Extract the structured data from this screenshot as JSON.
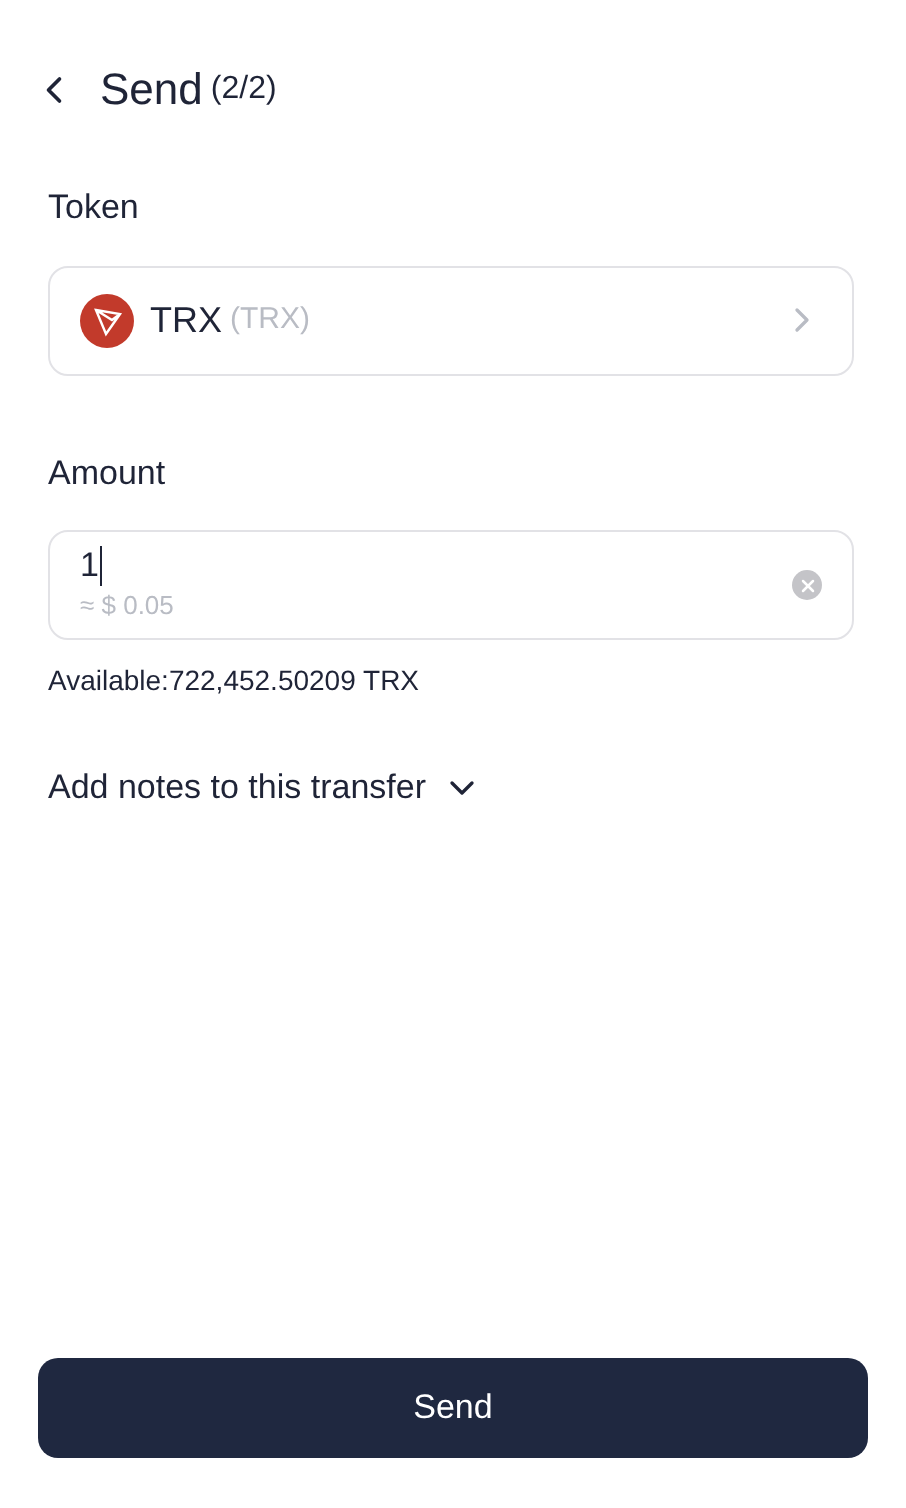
{
  "header": {
    "title": "Send",
    "step": "(2/2)"
  },
  "token": {
    "label": "Token",
    "name": "TRX",
    "symbol": "(TRX)"
  },
  "amount": {
    "label": "Amount",
    "value": "1",
    "fiat": "≈ $ 0.05",
    "available": "Available:722,452.50209 TRX"
  },
  "notes": {
    "label": "Add notes to this transfer",
    "expanded": false
  },
  "send_button": "Send"
}
